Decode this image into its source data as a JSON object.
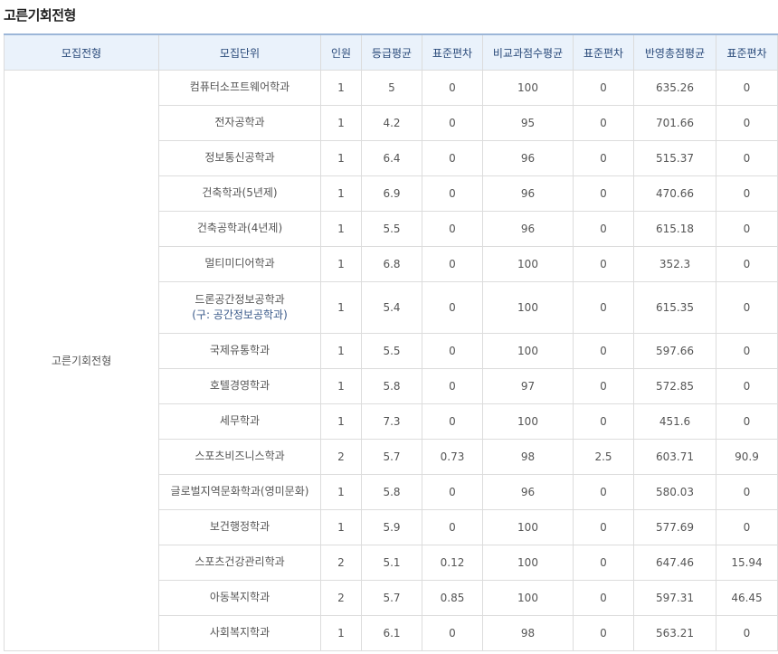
{
  "title": "고른기회전형",
  "headers": [
    "모집전형",
    "모집단위",
    "인원",
    "등급평균",
    "표준편차",
    "비교과점수평균",
    "표준편차",
    "반영총점평균",
    "표준편차"
  ],
  "group": "고른기회전형",
  "rows": [
    {
      "unit": "컴퓨터소프트웨어학과",
      "unit_sub": "",
      "count": "1",
      "grade_avg": "5",
      "grade_sd": "0",
      "extra_avg": "100",
      "extra_sd": "0",
      "total_avg": "635.26",
      "total_sd": "0"
    },
    {
      "unit": "전자공학과",
      "unit_sub": "",
      "count": "1",
      "grade_avg": "4.2",
      "grade_sd": "0",
      "extra_avg": "95",
      "extra_sd": "0",
      "total_avg": "701.66",
      "total_sd": "0"
    },
    {
      "unit": "정보통신공학과",
      "unit_sub": "",
      "count": "1",
      "grade_avg": "6.4",
      "grade_sd": "0",
      "extra_avg": "96",
      "extra_sd": "0",
      "total_avg": "515.37",
      "total_sd": "0"
    },
    {
      "unit": "건축학과(5년제)",
      "unit_sub": "",
      "count": "1",
      "grade_avg": "6.9",
      "grade_sd": "0",
      "extra_avg": "96",
      "extra_sd": "0",
      "total_avg": "470.66",
      "total_sd": "0"
    },
    {
      "unit": "건축공학과(4년제)",
      "unit_sub": "",
      "count": "1",
      "grade_avg": "5.5",
      "grade_sd": "0",
      "extra_avg": "96",
      "extra_sd": "0",
      "total_avg": "615.18",
      "total_sd": "0"
    },
    {
      "unit": "멀티미디어학과",
      "unit_sub": "",
      "count": "1",
      "grade_avg": "6.8",
      "grade_sd": "0",
      "extra_avg": "100",
      "extra_sd": "0",
      "total_avg": "352.3",
      "total_sd": "0"
    },
    {
      "unit": "드론공간정보공학과",
      "unit_sub": "(구: 공간정보공학과)",
      "count": "1",
      "grade_avg": "5.4",
      "grade_sd": "0",
      "extra_avg": "100",
      "extra_sd": "0",
      "total_avg": "615.35",
      "total_sd": "0"
    },
    {
      "unit": "국제유통학과",
      "unit_sub": "",
      "count": "1",
      "grade_avg": "5.5",
      "grade_sd": "0",
      "extra_avg": "100",
      "extra_sd": "0",
      "total_avg": "597.66",
      "total_sd": "0"
    },
    {
      "unit": "호텔경영학과",
      "unit_sub": "",
      "count": "1",
      "grade_avg": "5.8",
      "grade_sd": "0",
      "extra_avg": "97",
      "extra_sd": "0",
      "total_avg": "572.85",
      "total_sd": "0"
    },
    {
      "unit": "세무학과",
      "unit_sub": "",
      "count": "1",
      "grade_avg": "7.3",
      "grade_sd": "0",
      "extra_avg": "100",
      "extra_sd": "0",
      "total_avg": "451.6",
      "total_sd": "0"
    },
    {
      "unit": "스포츠비즈니스학과",
      "unit_sub": "",
      "count": "2",
      "grade_avg": "5.7",
      "grade_sd": "0.73",
      "extra_avg": "98",
      "extra_sd": "2.5",
      "total_avg": "603.71",
      "total_sd": "90.9"
    },
    {
      "unit": "글로벌지역문화학과(영미문화)",
      "unit_sub": "",
      "count": "1",
      "grade_avg": "5.8",
      "grade_sd": "0",
      "extra_avg": "96",
      "extra_sd": "0",
      "total_avg": "580.03",
      "total_sd": "0"
    },
    {
      "unit": "보건행정학과",
      "unit_sub": "",
      "count": "1",
      "grade_avg": "5.9",
      "grade_sd": "0",
      "extra_avg": "100",
      "extra_sd": "0",
      "total_avg": "577.69",
      "total_sd": "0"
    },
    {
      "unit": "스포츠건강관리학과",
      "unit_sub": "",
      "count": "2",
      "grade_avg": "5.1",
      "grade_sd": "0.12",
      "extra_avg": "100",
      "extra_sd": "0",
      "total_avg": "647.46",
      "total_sd": "15.94"
    },
    {
      "unit": "아동복지학과",
      "unit_sub": "",
      "count": "2",
      "grade_avg": "5.7",
      "grade_sd": "0.85",
      "extra_avg": "100",
      "extra_sd": "0",
      "total_avg": "597.31",
      "total_sd": "46.45"
    },
    {
      "unit": "사회복지학과",
      "unit_sub": "",
      "count": "1",
      "grade_avg": "6.1",
      "grade_sd": "0",
      "extra_avg": "98",
      "extra_sd": "0",
      "total_avg": "563.21",
      "total_sd": "0"
    }
  ]
}
